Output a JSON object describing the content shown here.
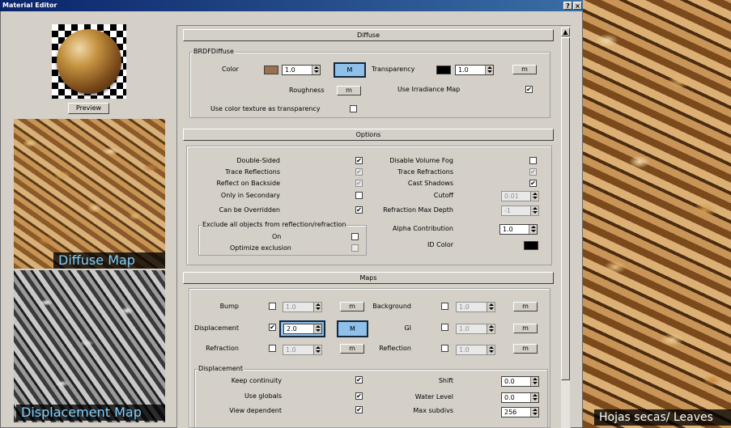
{
  "window": {
    "title": "Material Editor",
    "help_glyph": "?",
    "close_glyph": "×"
  },
  "left": {
    "preview_button": "Preview",
    "diffuse_map_label": "Diffuse Map",
    "displacement_map_label": "Displacement Map"
  },
  "right": {
    "photo_label": "Hojas secas/ Leaves"
  },
  "diffuse": {
    "header": "Diffuse",
    "group": "BRDFDiffuse",
    "color_label": "Color",
    "color_swatch": "#9b7050",
    "color_value": "1.0",
    "color_map_btn": "M",
    "transparency_label": "Transparency",
    "transparency_swatch": "#000000",
    "transparency_value": "1.0",
    "transparency_map_btn": "m",
    "roughness_label": "Roughness",
    "roughness_btn": "m",
    "use_irradiance_label": "Use Irradiance Map",
    "use_irradiance": "✔",
    "use_color_texture_label": "Use color texture as transparency",
    "use_color_texture": ""
  },
  "options": {
    "header": "Options",
    "double_sided_label": "Double-Sided",
    "double_sided": "✔",
    "trace_reflections_label": "Trace Reflections",
    "trace_reflections": "✔",
    "reflect_backside_label": "Reflect on Backside",
    "reflect_backside": "✔",
    "only_secondary_label": "Only in Secondary",
    "only_secondary": "",
    "can_be_overridden_label": "Can be Overridden",
    "can_be_overridden": "✔",
    "disable_volume_fog_label": "Disable Volume Fog",
    "disable_volume_fog": "",
    "trace_refractions_label": "Trace Refractions",
    "trace_refractions": "✔",
    "cast_shadows_label": "Cast Shadows",
    "cast_shadows": "✔",
    "cutoff_label": "Cutoff",
    "cutoff": "0.01",
    "refraction_max_depth_label": "Refraction Max Depth",
    "refraction_max_depth": "-1",
    "alpha_contribution_label": "Alpha Contribution",
    "alpha_contribution": "1.0",
    "id_color_label": "ID Color",
    "id_color": "#000000",
    "exclude_group": "Exclude all objects from reflection/refraction",
    "exclude_on_label": "On",
    "exclude_on": "",
    "optimize_exclusion_label": "Optimize exclusion",
    "optimize_exclusion": ""
  },
  "maps": {
    "header": "Maps",
    "bump_label": "Bump",
    "bump_value": "1.0",
    "bump_btn": "m",
    "displacement_label": "Displacement",
    "displacement_check": "✔",
    "displacement_value": "2.0",
    "displacement_btn": "M",
    "refraction_label": "Refraction",
    "refraction_value": "1.0",
    "refraction_btn": "m",
    "background_label": "Background",
    "background_value": "1.0",
    "background_btn": "m",
    "gi_label": "GI",
    "gi_value": "1.0",
    "gi_btn": "m",
    "reflection_label": "Reflection",
    "reflection_value": "1.0",
    "reflection_btn": "m"
  },
  "displacement": {
    "group": "Displacement",
    "keep_continuity_label": "Keep continuity",
    "keep_continuity": "✔",
    "use_globals_label": "Use globals",
    "use_globals": "✔",
    "view_dependent_label": "View dependent",
    "view_dependent": "✔",
    "shift_label": "Shift",
    "shift": "0.0",
    "water_level_label": "Water Level",
    "water_level": "0.0",
    "max_subdivs_label": "Max subdivs",
    "max_subdivs": "256"
  }
}
